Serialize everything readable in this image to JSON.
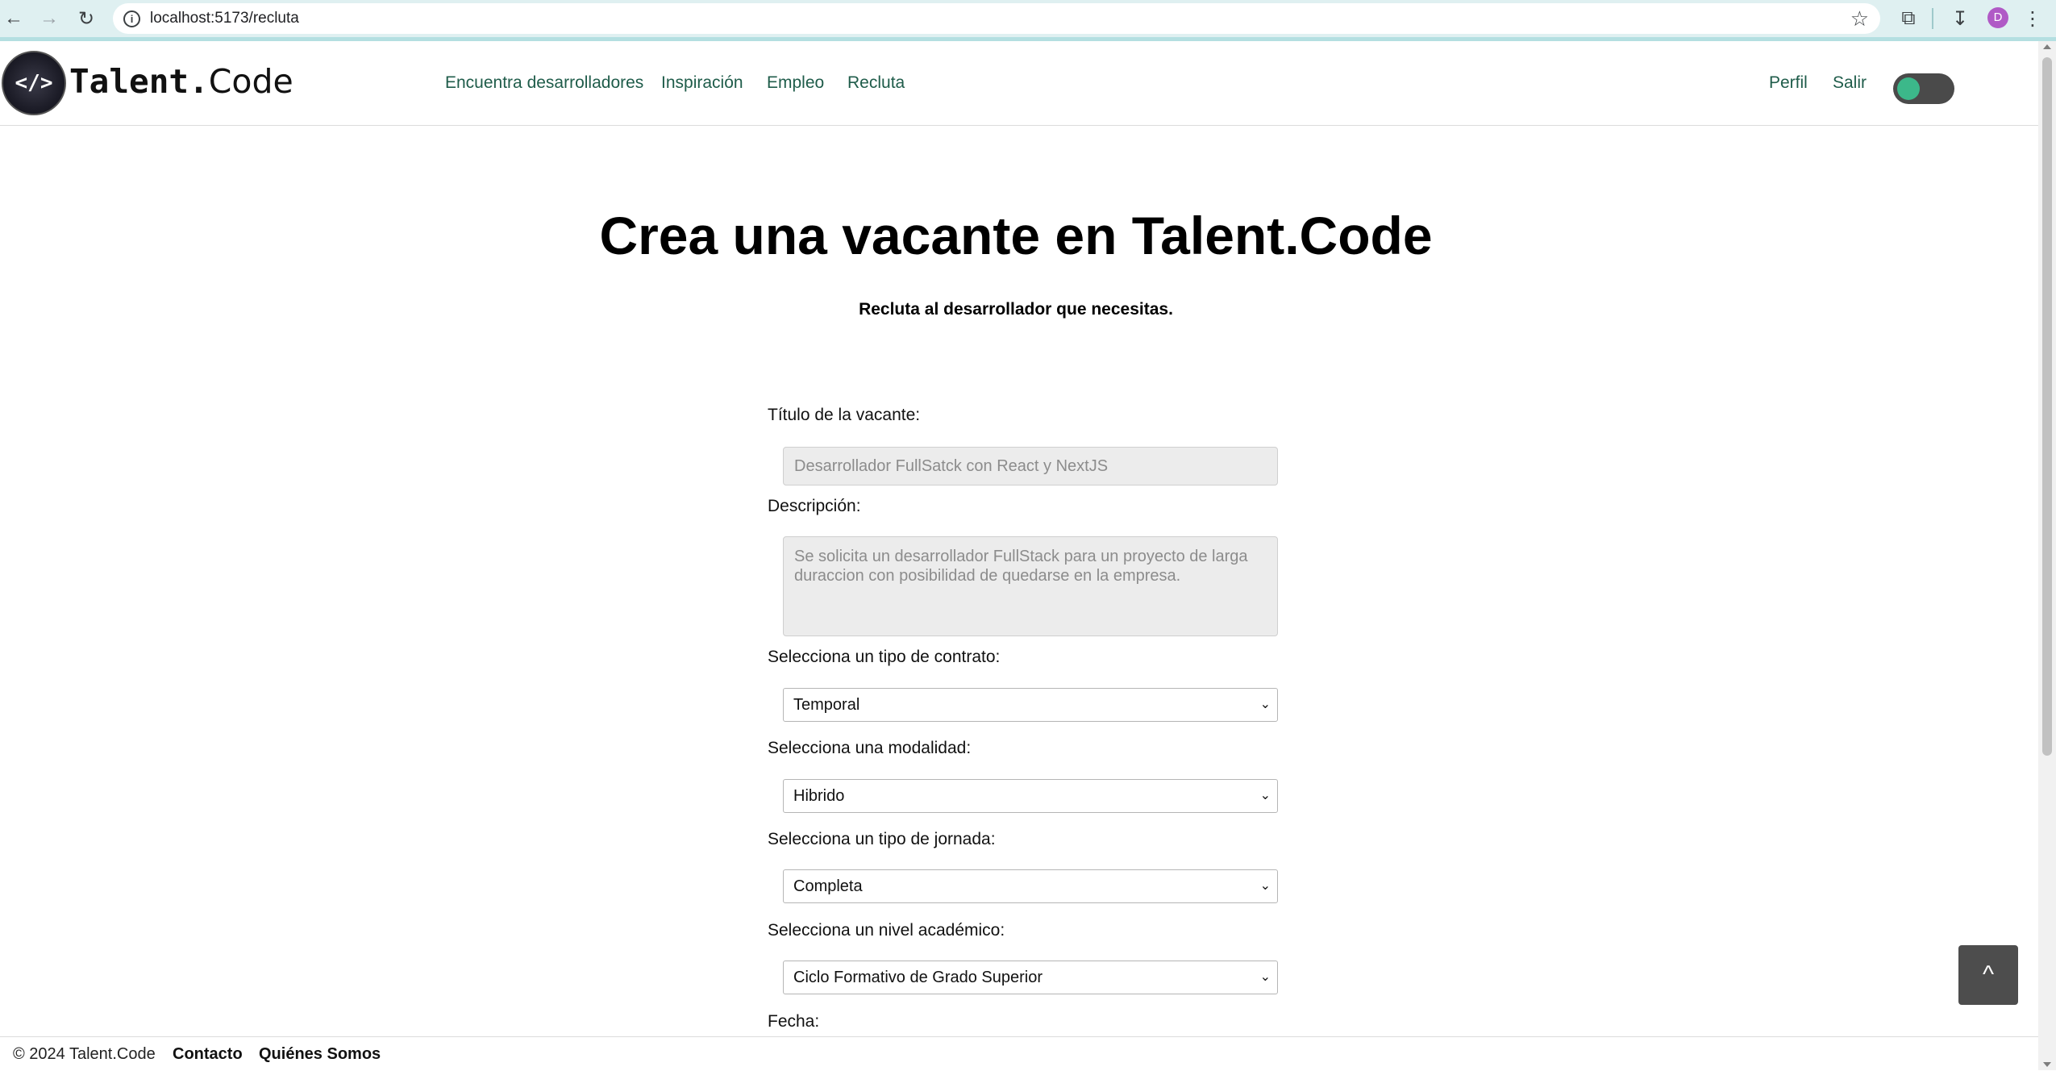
{
  "browser": {
    "url": "localhost:5173/recluta",
    "profile_initial": "D"
  },
  "header": {
    "brand_part1": "Talent.",
    "brand_part2": "Code",
    "logo_glyph": "</>",
    "nav": [
      {
        "label": "Encuentra desarrolladores"
      },
      {
        "label": "Inspiración"
      },
      {
        "label": "Empleo"
      },
      {
        "label": "Recluta"
      }
    ],
    "right": [
      {
        "label": "Perfil"
      },
      {
        "label": "Salir"
      }
    ],
    "theme_toggle_on": false,
    "colors": {
      "nav_link": "#1f5c4a",
      "toggle_knob": "#3cb88a",
      "toggle_track": "#4a4a4a"
    }
  },
  "main": {
    "title": "Crea una vacante en Talent.Code",
    "subtitle": "Recluta al desarrollador que necesitas.",
    "form": {
      "title_label": "Título de la vacante:",
      "title_placeholder": "Desarrollador FullSatck con React y NextJS",
      "description_label": "Descripción:",
      "description_placeholder": "Se solicita un desarrollador FullStack para un proyecto de larga duraccion con posibilidad de quedarse en la empresa.",
      "contract_label": "Selecciona un tipo de contrato:",
      "contract_value": "Temporal",
      "modality_label": "Selecciona una modalidad:",
      "modality_value": "Hibrido",
      "schedule_label": "Selecciona un tipo de jornada:",
      "schedule_value": "Completa",
      "education_label": "Selecciona un nivel académico:",
      "education_value": "Ciclo Formativo de Grado Superior",
      "date_label": "Fecha:"
    }
  },
  "scroll_top_label": "^",
  "footer": {
    "copyright": "© 2024 Talent.Code",
    "links": [
      {
        "label": "Contacto"
      },
      {
        "label": "Quiénes Somos"
      }
    ]
  }
}
